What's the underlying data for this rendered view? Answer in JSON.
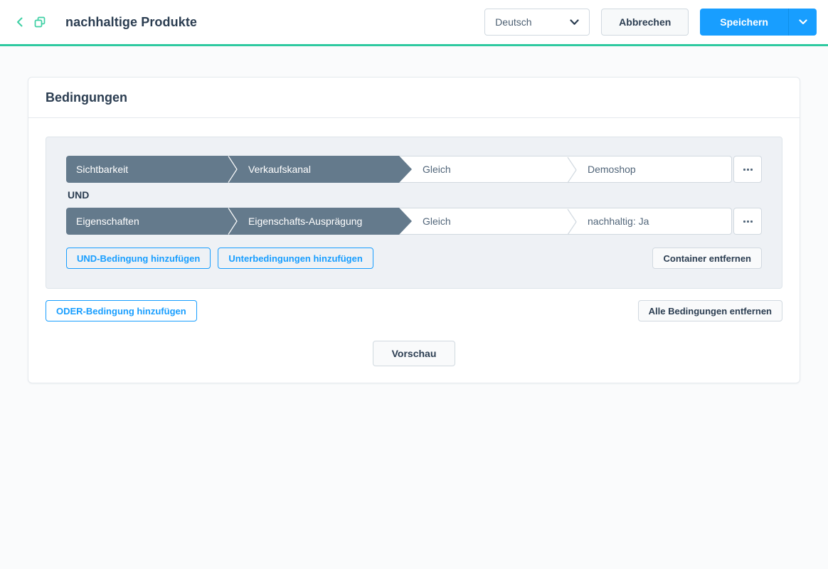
{
  "header": {
    "title": "nachhaltige Produkte",
    "language_select": {
      "value": "Deutsch"
    },
    "cancel_label": "Abbrechen",
    "save_label": "Speichern"
  },
  "icons": {
    "back": "chevron-left",
    "duplicate": "copy",
    "language_chevron": "chevron-down",
    "save_chevron": "chevron-down",
    "row_context_menu": "ellipsis"
  },
  "card": {
    "title": "Bedingungen",
    "container": {
      "operator_label": "UND",
      "rows": [
        {
          "type": "Sichtbarkeit",
          "subtype": "Verkaufskanal",
          "operator": "Gleich",
          "value": "Demoshop"
        },
        {
          "type": "Eigenschaften",
          "subtype": "Eigenschafts-Ausprägung",
          "operator": "Gleich",
          "value": "nachhaltig: Ja"
        }
      ],
      "and_button": "UND-Bedingung hinzufügen",
      "sub_button": "Unterbedingungen hinzufügen",
      "remove_container_button": "Container entfernen"
    },
    "or_button": "ODER-Bedingung hinzufügen",
    "remove_all_button": "Alle Bedingungen entfernen",
    "preview_button": "Vorschau"
  },
  "colors": {
    "accent_teal": "#2ec9a0",
    "primary_blue": "#189eff",
    "condition_slate": "#647a8c",
    "text_dark": "#2b3d51",
    "text_muted": "#52667a",
    "border": "#d1d9e0",
    "container_bg": "#eef1f5"
  }
}
